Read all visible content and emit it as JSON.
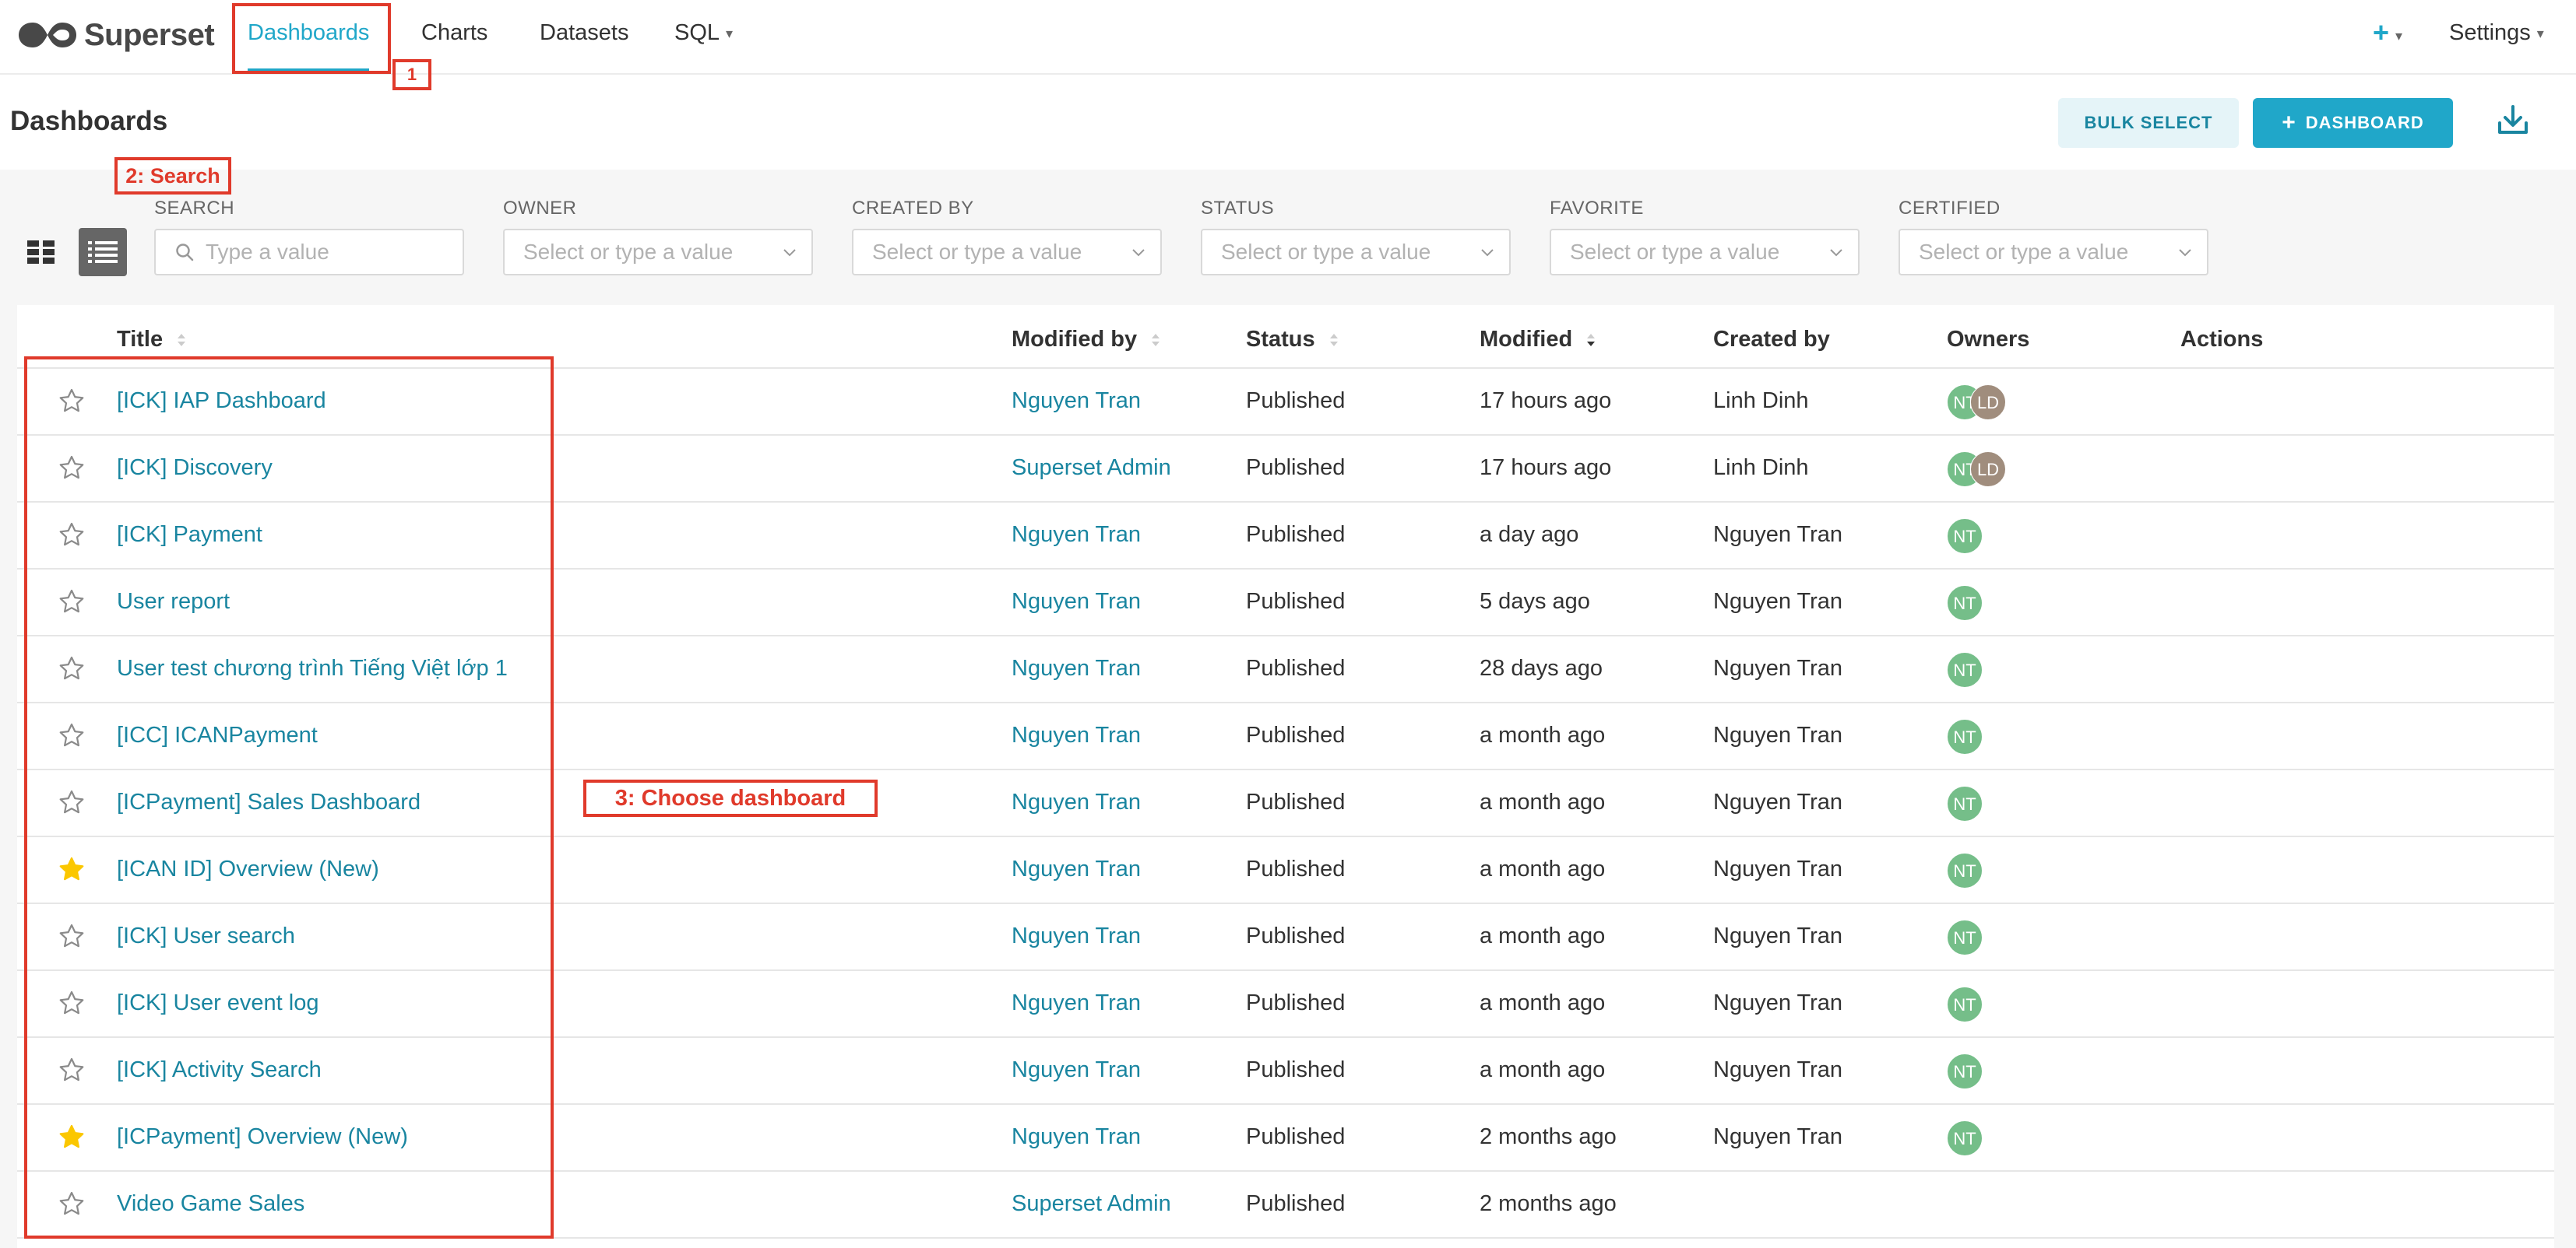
{
  "brand": {
    "name": "Superset"
  },
  "nav": {
    "items": [
      {
        "label": "Dashboards",
        "active": true
      },
      {
        "label": "Charts"
      },
      {
        "label": "Datasets"
      },
      {
        "label": "SQL"
      }
    ],
    "settings_label": "Settings"
  },
  "header": {
    "title": "Dashboards",
    "bulk_select": "BULK SELECT",
    "add_dashboard": "DASHBOARD"
  },
  "filters": {
    "search": {
      "label": "SEARCH",
      "placeholder": "Type a value"
    },
    "owner": {
      "label": "OWNER",
      "placeholder": "Select or type a value"
    },
    "created_by": {
      "label": "CREATED BY",
      "placeholder": "Select or type a value"
    },
    "status": {
      "label": "STATUS",
      "placeholder": "Select or type a value"
    },
    "favorite": {
      "label": "FAVORITE",
      "placeholder": "Select or type a value"
    },
    "certified": {
      "label": "CERTIFIED",
      "placeholder": "Select or type a value"
    }
  },
  "table": {
    "columns": {
      "title": "Title",
      "modified_by": "Modified by",
      "status": "Status",
      "modified": "Modified",
      "created_by": "Created by",
      "owners": "Owners",
      "actions": "Actions"
    },
    "rows": [
      {
        "favorite": false,
        "title": "[ICK] IAP Dashboard",
        "modified_by": "Nguyen Tran",
        "status": "Published",
        "modified": "17 hours ago",
        "created_by": "Linh Dinh",
        "owners": [
          "NT",
          "LD"
        ]
      },
      {
        "favorite": false,
        "title": "[ICK] Discovery",
        "modified_by": "Superset Admin",
        "status": "Published",
        "modified": "17 hours ago",
        "created_by": "Linh Dinh",
        "owners": [
          "NT",
          "LD"
        ]
      },
      {
        "favorite": false,
        "title": "[ICK] Payment",
        "modified_by": "Nguyen Tran",
        "status": "Published",
        "modified": "a day ago",
        "created_by": "Nguyen Tran",
        "owners": [
          "NT"
        ]
      },
      {
        "favorite": false,
        "title": "User report",
        "modified_by": "Nguyen Tran",
        "status": "Published",
        "modified": "5 days ago",
        "created_by": "Nguyen Tran",
        "owners": [
          "NT"
        ]
      },
      {
        "favorite": false,
        "title": "User test chương trình Tiếng Việt lớp 1",
        "modified_by": "Nguyen Tran",
        "status": "Published",
        "modified": "28 days ago",
        "created_by": "Nguyen Tran",
        "owners": [
          "NT"
        ]
      },
      {
        "favorite": false,
        "title": "[ICC] ICANPayment",
        "modified_by": "Nguyen Tran",
        "status": "Published",
        "modified": "a month ago",
        "created_by": "Nguyen Tran",
        "owners": [
          "NT"
        ]
      },
      {
        "favorite": false,
        "title": "[ICPayment] Sales Dashboard",
        "modified_by": "Nguyen Tran",
        "status": "Published",
        "modified": "a month ago",
        "created_by": "Nguyen Tran",
        "owners": [
          "NT"
        ]
      },
      {
        "favorite": true,
        "title": "[ICAN ID] Overview (New)",
        "modified_by": "Nguyen Tran",
        "status": "Published",
        "modified": "a month ago",
        "created_by": "Nguyen Tran",
        "owners": [
          "NT"
        ]
      },
      {
        "favorite": false,
        "title": "[ICK] User search",
        "modified_by": "Nguyen Tran",
        "status": "Published",
        "modified": "a month ago",
        "created_by": "Nguyen Tran",
        "owners": [
          "NT"
        ]
      },
      {
        "favorite": false,
        "title": "[ICK] User event log",
        "modified_by": "Nguyen Tran",
        "status": "Published",
        "modified": "a month ago",
        "created_by": "Nguyen Tran",
        "owners": [
          "NT"
        ]
      },
      {
        "favorite": false,
        "title": "[ICK] Activity Search",
        "modified_by": "Nguyen Tran",
        "status": "Published",
        "modified": "a month ago",
        "created_by": "Nguyen Tran",
        "owners": [
          "NT"
        ]
      },
      {
        "favorite": true,
        "title": "[ICPayment] Overview (New)",
        "modified_by": "Nguyen Tran",
        "status": "Published",
        "modified": "2 months ago",
        "created_by": "Nguyen Tran",
        "owners": [
          "NT"
        ]
      },
      {
        "favorite": false,
        "title": "Video Game Sales",
        "modified_by": "Superset Admin",
        "status": "Published",
        "modified": "2 months ago",
        "created_by": "",
        "owners": []
      }
    ]
  },
  "annotations": {
    "step1": "1",
    "step2": "2: Search",
    "step3": "3: Choose dashboard"
  },
  "colors": {
    "accent": "#20a7c9",
    "link": "#1985a0",
    "annotation": "#e03a2b",
    "favorite_star": "#fbc700"
  }
}
